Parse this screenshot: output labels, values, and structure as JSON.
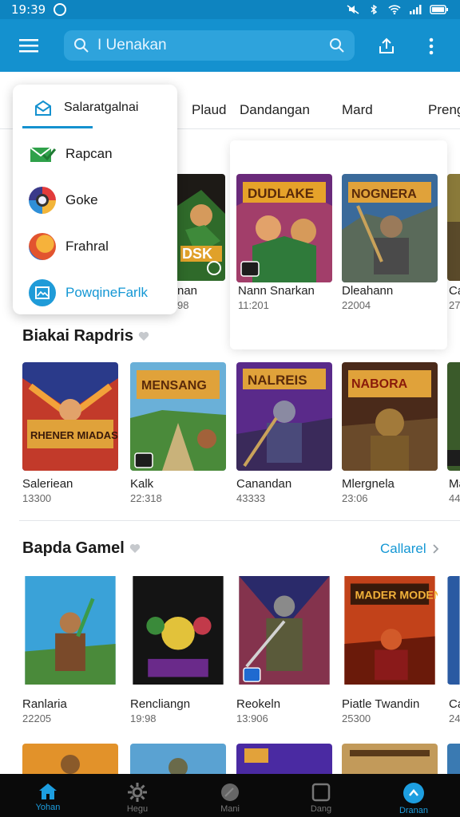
{
  "status_bar": {
    "time": "19:39"
  },
  "search": {
    "value": "I Uenakan"
  },
  "tabs": [
    "Plaud",
    "Dandangan",
    "Mard",
    "Preng"
  ],
  "dropdown": {
    "header": "Salaratgalnai",
    "items": [
      {
        "label": "Rapcan",
        "icon": "envelope-check-icon"
      },
      {
        "label": "Goke",
        "icon": "camera-icon"
      },
      {
        "label": "Frahral",
        "icon": "lion-icon"
      },
      {
        "label": "PowqineFarlk",
        "icon": "picture-icon"
      }
    ]
  },
  "top_row": {
    "items": [
      {
        "name": "nan",
        "sub": "98",
        "art": "DSK"
      },
      {
        "name": "Nann Snarkan",
        "sub": "11:201",
        "art": "DUDLAKE"
      },
      {
        "name": "Dleahann",
        "sub": "22004",
        "art": "NOGNERA"
      },
      {
        "name": "Ca",
        "sub": "27",
        "art": ""
      }
    ]
  },
  "section1": {
    "title": "Biakai Rapdris",
    "items": [
      {
        "name": "Saleriean",
        "sub": "13300",
        "art": "RHENER MIADAS"
      },
      {
        "name": "Kalk",
        "sub": "22:318",
        "art": "MENSANG"
      },
      {
        "name": "Canandan",
        "sub": "43333",
        "art": "NALREIS"
      },
      {
        "name": "Mlergnela",
        "sub": "23:06",
        "art": "NABORA"
      },
      {
        "name": "Ma",
        "sub": "44",
        "art": ""
      }
    ]
  },
  "section2": {
    "title": "Bapda Gamel",
    "see_all": "Callarel",
    "items": [
      {
        "name": "Ranlaria",
        "sub": "22205",
        "art": ""
      },
      {
        "name": "Rencliangn",
        "sub": "19:98",
        "art": ""
      },
      {
        "name": "Reokeln",
        "sub": "13:906",
        "art": ""
      },
      {
        "name": "Piatle Twandin",
        "sub": "25300",
        "art": "MADER MODENT"
      },
      {
        "name": "Ca",
        "sub": "24",
        "art": ""
      }
    ]
  },
  "bottom_nav": [
    {
      "label": "Yohan",
      "icon": "home-icon",
      "active": true
    },
    {
      "label": "Hegu",
      "icon": "gear-icon",
      "active": false
    },
    {
      "label": "Mani",
      "icon": "disc-icon",
      "active": false
    },
    {
      "label": "Dang",
      "icon": "square-icon",
      "active": false
    },
    {
      "label": "Dranan",
      "icon": "profile-icon",
      "active": false
    }
  ],
  "colors": {
    "primary": "#1491cf",
    "accent": "#1497d4",
    "nav_bg": "#0a0a0a"
  }
}
